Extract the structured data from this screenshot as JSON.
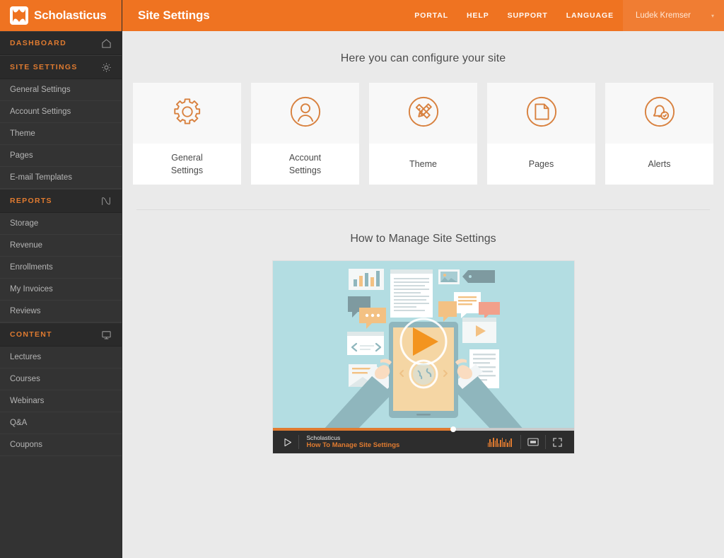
{
  "brand": {
    "name": "Scholasticus",
    "logo_icon": "scholasticus-logo-icon",
    "accent": "#ef7321",
    "sidebar_bg": "#333333",
    "page_bg": "#eaeaea"
  },
  "header": {
    "title": "Site Settings",
    "nav": [
      {
        "label": "PORTAL",
        "name": "portal"
      },
      {
        "label": "HELP",
        "name": "help"
      },
      {
        "label": "SUPPORT",
        "name": "support"
      },
      {
        "label": "LANGUAGE",
        "name": "language"
      }
    ],
    "user": {
      "name": "Ludek Kremser",
      "caret": "▾"
    }
  },
  "sidebar": {
    "sections": [
      {
        "label": "DASHBOARD",
        "icon": "home-icon",
        "items": []
      },
      {
        "label": "SITE SETTINGS",
        "icon": "gear-icon",
        "items": [
          {
            "label": "General Settings"
          },
          {
            "label": "Account Settings"
          },
          {
            "label": "Theme"
          },
          {
            "label": "Pages"
          },
          {
            "label": "E-mail Templates"
          }
        ]
      },
      {
        "label": "REPORTS",
        "icon": "chart-line-icon",
        "items": [
          {
            "label": "Storage"
          },
          {
            "label": "Revenue"
          },
          {
            "label": "Enrollments"
          },
          {
            "label": "My Invoices"
          },
          {
            "label": "Reviews"
          }
        ]
      },
      {
        "label": "CONTENT",
        "icon": "monitor-icon",
        "items": [
          {
            "label": "Lectures"
          },
          {
            "label": "Courses"
          },
          {
            "label": "Webinars"
          },
          {
            "label": "Q&A"
          },
          {
            "label": "Coupons"
          }
        ]
      }
    ]
  },
  "main": {
    "intro": "Here you can configure your site",
    "cards": [
      {
        "label": "General\nSettings",
        "icon": "gear-icon",
        "name": "general-settings"
      },
      {
        "label": "Account\nSettings",
        "icon": "user-circle-icon",
        "name": "account-settings"
      },
      {
        "label": "Theme",
        "icon": "pencil-ruler-circle-icon",
        "name": "theme"
      },
      {
        "label": "Pages",
        "icon": "document-circle-icon",
        "name": "pages"
      },
      {
        "label": "Alerts",
        "icon": "bell-check-circle-icon",
        "name": "alerts"
      }
    ],
    "section_title": "How to Manage Site Settings",
    "video": {
      "brand": "Scholasticus",
      "title": "How To Manage Site Settings",
      "play_icon": "play-icon",
      "equalizer_icon": "equalizer-icon",
      "picture_in_picture_icon": "picture-in-picture-icon",
      "fullscreen_icon": "fullscreen-icon",
      "progress_percent": 60,
      "poster_bg": "#b3dde2",
      "poster_accent": "#f3941f"
    }
  }
}
